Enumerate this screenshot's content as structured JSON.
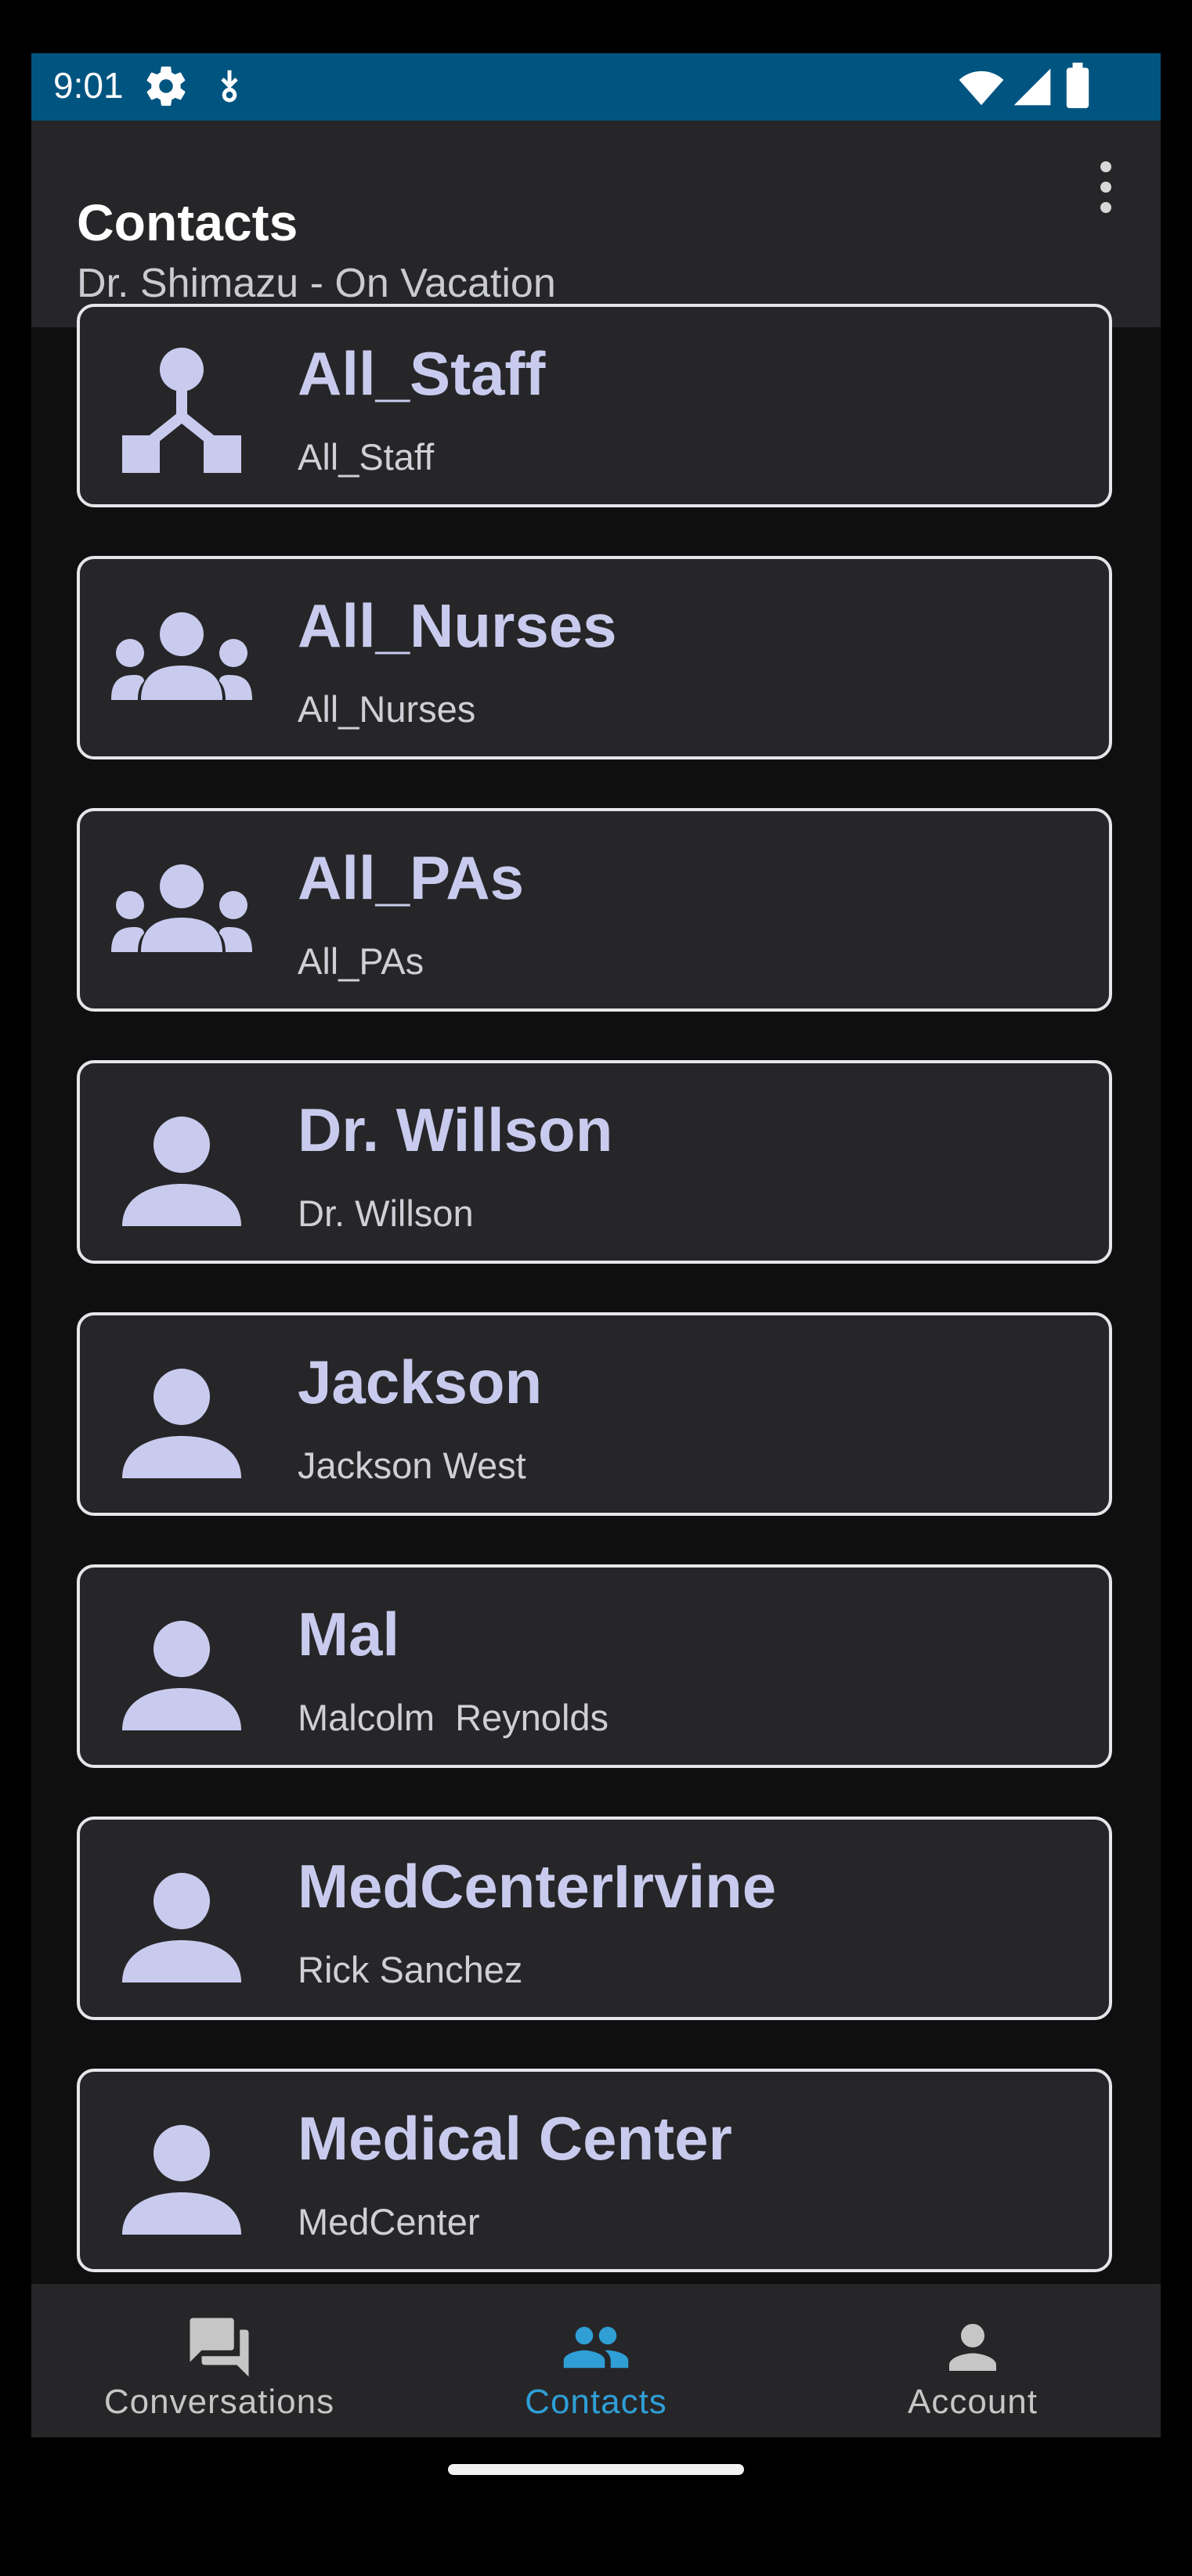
{
  "status_bar": {
    "time": "9:01",
    "left_icons": [
      "gear-icon",
      "download-icon"
    ],
    "right_icons": [
      "wifi-icon",
      "signal-icon",
      "battery-icon"
    ]
  },
  "header": {
    "title": "Contacts",
    "subtitle": "Dr. Shimazu - On Vacation",
    "menu_icon": "more-vert-icon"
  },
  "contacts": [
    {
      "title": "All_Staff",
      "subtitle": "All_Staff",
      "icon": "hierarchy-icon"
    },
    {
      "title": "All_Nurses",
      "subtitle": "All_Nurses",
      "icon": "group-icon"
    },
    {
      "title": "All_PAs",
      "subtitle": "All_PAs",
      "icon": "group-icon"
    },
    {
      "title": "Dr. Willson",
      "subtitle": "Dr. Willson",
      "icon": "person-icon"
    },
    {
      "title": "Jackson",
      "subtitle": "Jackson West",
      "icon": "person-icon"
    },
    {
      "title": "Mal",
      "subtitle": "Malcolm  Reynolds",
      "icon": "person-icon"
    },
    {
      "title": "MedCenterIrvine",
      "subtitle": "Rick Sanchez",
      "icon": "person-icon"
    },
    {
      "title": "Medical Center",
      "subtitle": "MedCenter",
      "icon": "person-icon"
    }
  ],
  "bottom_nav": {
    "items": [
      {
        "label": "Conversations",
        "icon": "forum-icon",
        "active": false
      },
      {
        "label": "Contacts",
        "icon": "people-icon",
        "active": true
      },
      {
        "label": "Account",
        "icon": "account-icon",
        "active": false
      }
    ]
  },
  "colors": {
    "status_bar": "#005480",
    "app_bar": "#262628",
    "background": "#0f0f10",
    "card_text": "#c9cbee",
    "active_nav": "#2f9fd6",
    "inactive_nav": "#c6c6c6"
  }
}
